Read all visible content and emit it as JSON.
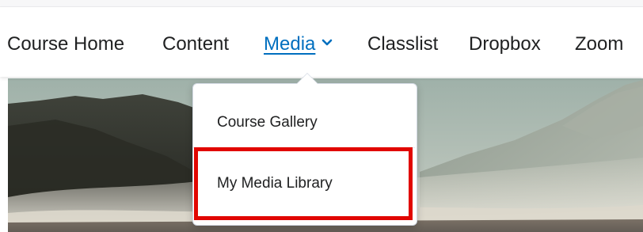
{
  "nav": {
    "items": [
      {
        "label": "Course Home"
      },
      {
        "label": "Content"
      },
      {
        "label": "Media"
      },
      {
        "label": "Classlist"
      },
      {
        "label": "Dropbox"
      },
      {
        "label": "Zoom"
      }
    ],
    "active_item": "Media",
    "active_icon": "chevron-down-icon"
  },
  "dropdown": {
    "items": [
      {
        "label": "Course Gallery"
      },
      {
        "label": "My Media Library"
      }
    ],
    "highlighted_item": "My Media Library"
  },
  "colors": {
    "accent": "#006fbf",
    "text": "#202122",
    "highlight": "#e10600"
  }
}
